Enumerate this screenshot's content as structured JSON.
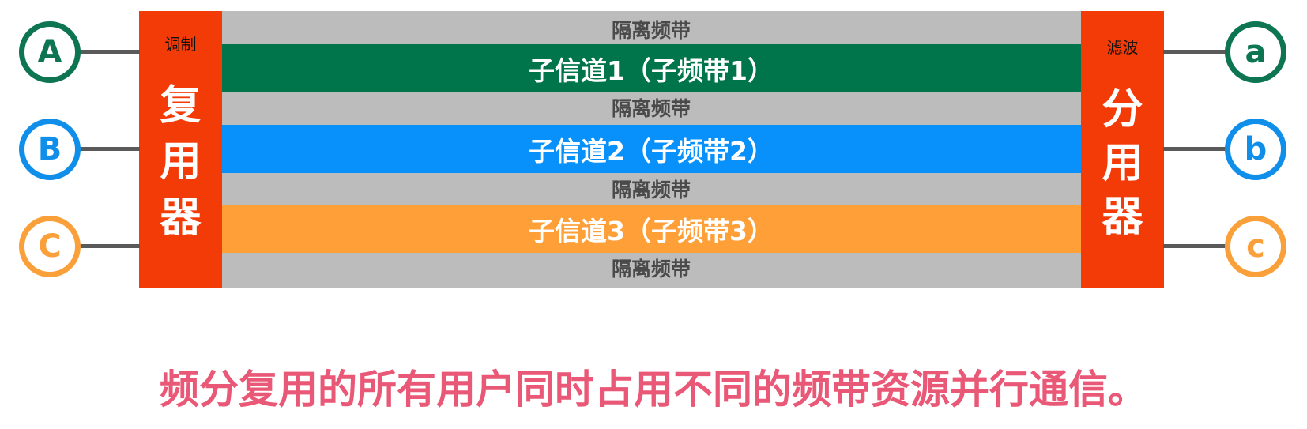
{
  "colors": {
    "device": "#f23b06",
    "guard_band": "#bcbcbc",
    "sub1": "#00744a",
    "sub2": "#0891fa",
    "sub3": "#fe9f38",
    "caption": "#e95876"
  },
  "guard_label": "隔离频带",
  "bands": [
    {
      "label": "子信道1（子频带1）"
    },
    {
      "label": "子信道2（子频带2）"
    },
    {
      "label": "子信道3（子频带3）"
    }
  ],
  "mux": {
    "small": "调制",
    "chars": [
      "复",
      "用",
      "器"
    ]
  },
  "demux": {
    "small": "滤波",
    "chars": [
      "分",
      "用",
      "器"
    ]
  },
  "inputs": [
    "A",
    "B",
    "C"
  ],
  "outputs": [
    "a",
    "b",
    "c"
  ],
  "caption": "频分复用的所有用户同时占用不同的频带资源并行通信。"
}
